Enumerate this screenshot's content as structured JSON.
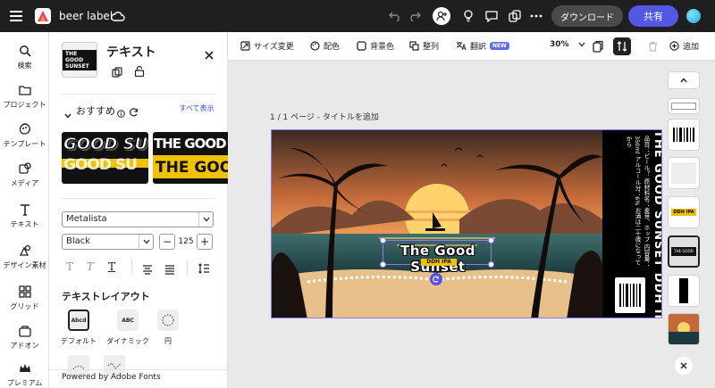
{
  "app": {
    "doc_title": "beer label"
  },
  "topbar": {
    "download_label": "ダウンロード",
    "share_label": "共有"
  },
  "rail": {
    "items": [
      {
        "label": "検索",
        "icon": "search-icon"
      },
      {
        "label": "プロジェクト",
        "icon": "folder-icon"
      },
      {
        "label": "テンプレート",
        "icon": "template-icon"
      },
      {
        "label": "メディア",
        "icon": "media-icon"
      },
      {
        "label": "テキスト",
        "icon": "text-icon"
      },
      {
        "label": "デザイン素材",
        "icon": "shapes-icon"
      },
      {
        "label": "グリッド",
        "icon": "grid-icon"
      },
      {
        "label": "アドオン",
        "icon": "addon-icon"
      },
      {
        "label": "プレミアム",
        "icon": "crown-icon"
      }
    ]
  },
  "panel": {
    "title": "テキスト",
    "thumb_text": "THE GOOD SUNSET",
    "recommend_label": "おすすめ",
    "show_all_label": "すべて表示",
    "font_family": "Metalista",
    "font_color": "Black",
    "font_size": "125",
    "layout_section_label": "テキストレイアウト",
    "layouts": [
      {
        "label": "デフォルト",
        "tile": "Abcd"
      },
      {
        "label": "ダイナミック",
        "tile": "ABC"
      },
      {
        "label": "円",
        "tile": ""
      }
    ],
    "footer": "Powered by Adobe Fonts",
    "preview_text_1": "GOOD SU",
    "preview_text_2": "THE GOOD SUN"
  },
  "toolbar": {
    "resize_label": "サイズ変更",
    "color_label": "配色",
    "bg_label": "背景色",
    "align_label": "整列",
    "translate_label": "翻訳",
    "new_badge": "NEW",
    "zoom": "30%",
    "add_label": "追加"
  },
  "canvas": {
    "page_title": "1 / 1 ページ - タイトルを追加",
    "headline": "The Good Sunset",
    "subline": "DDH IPA",
    "side_title": "THE GOOD SUNSET DDH IPA",
    "side_info": "品目：ビール？ 原材料名：麦芽、ホップ 内容量：350ml アルコール分：6% お酒は二十歳になってから"
  },
  "colors": {
    "accent": "#5258e4",
    "selection": "#8a7cf0",
    "sunset_orange": "#f5a45a",
    "sunset_yellow": "#ffd36b",
    "sea": "#2d5a5c",
    "label_yellow": "#f2c200"
  }
}
